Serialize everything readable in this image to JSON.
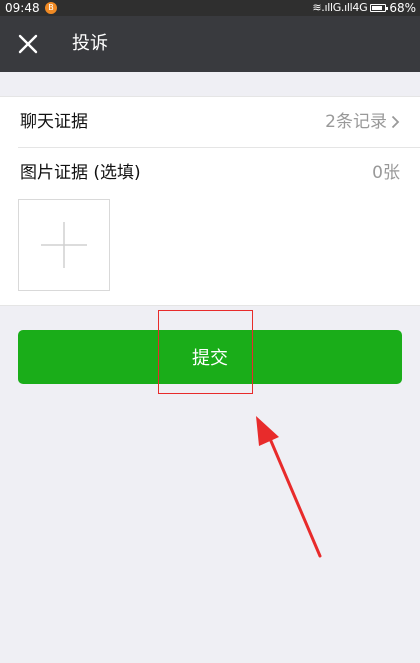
{
  "status_bar": {
    "time": "09:48",
    "notification_badge": "B",
    "network": "≋.ıllG.ıll4G",
    "battery": "68%"
  },
  "title_bar": {
    "close_icon": "close-icon",
    "title": "投诉"
  },
  "evidence": {
    "chat": {
      "label": "聊天证据",
      "value": "2条记录",
      "chevron_icon": "chevron-right-icon"
    },
    "images": {
      "label": "图片证据 (选填)",
      "count": "0张",
      "add_icon": "plus-icon"
    }
  },
  "actions": {
    "submit_label": "提交"
  },
  "colors": {
    "accent": "#1aad19",
    "title_bar": "#393a3e",
    "annotation": "#e82b2b"
  }
}
